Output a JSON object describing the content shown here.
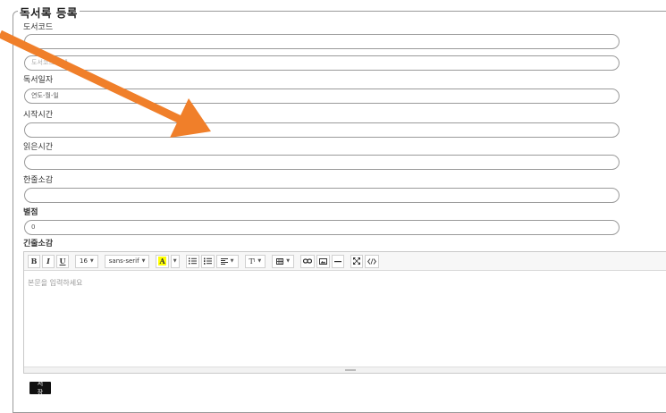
{
  "form": {
    "legend": "독서록 등록",
    "fields": [
      {
        "label": "도서코드",
        "value": "",
        "placeholder": ""
      },
      {
        "label": "",
        "value": "",
        "placeholder": "도서코드 검색"
      },
      {
        "label": "독서일자",
        "value": "연도-월-일",
        "placeholder": ""
      },
      {
        "label": "시작시간",
        "value": "",
        "placeholder": ""
      },
      {
        "label": "읽은시간",
        "value": "",
        "placeholder": ""
      },
      {
        "label": "한줄소감",
        "value": "",
        "placeholder": ""
      },
      {
        "label": "별점",
        "value": "0",
        "placeholder": ""
      }
    ],
    "editor_label": "긴줄소감",
    "save_label": "저장"
  },
  "editor": {
    "toolbar": {
      "bold": "B",
      "italic": "I",
      "underline": "U",
      "font_size": "16",
      "font_family": "sans-serif",
      "color": "A",
      "style": "T"
    },
    "placeholder": "본문을 입력하세요"
  },
  "colors": {
    "arrow": "#f07f2a",
    "highlight": "#ffff00",
    "button_bg": "#111111"
  }
}
